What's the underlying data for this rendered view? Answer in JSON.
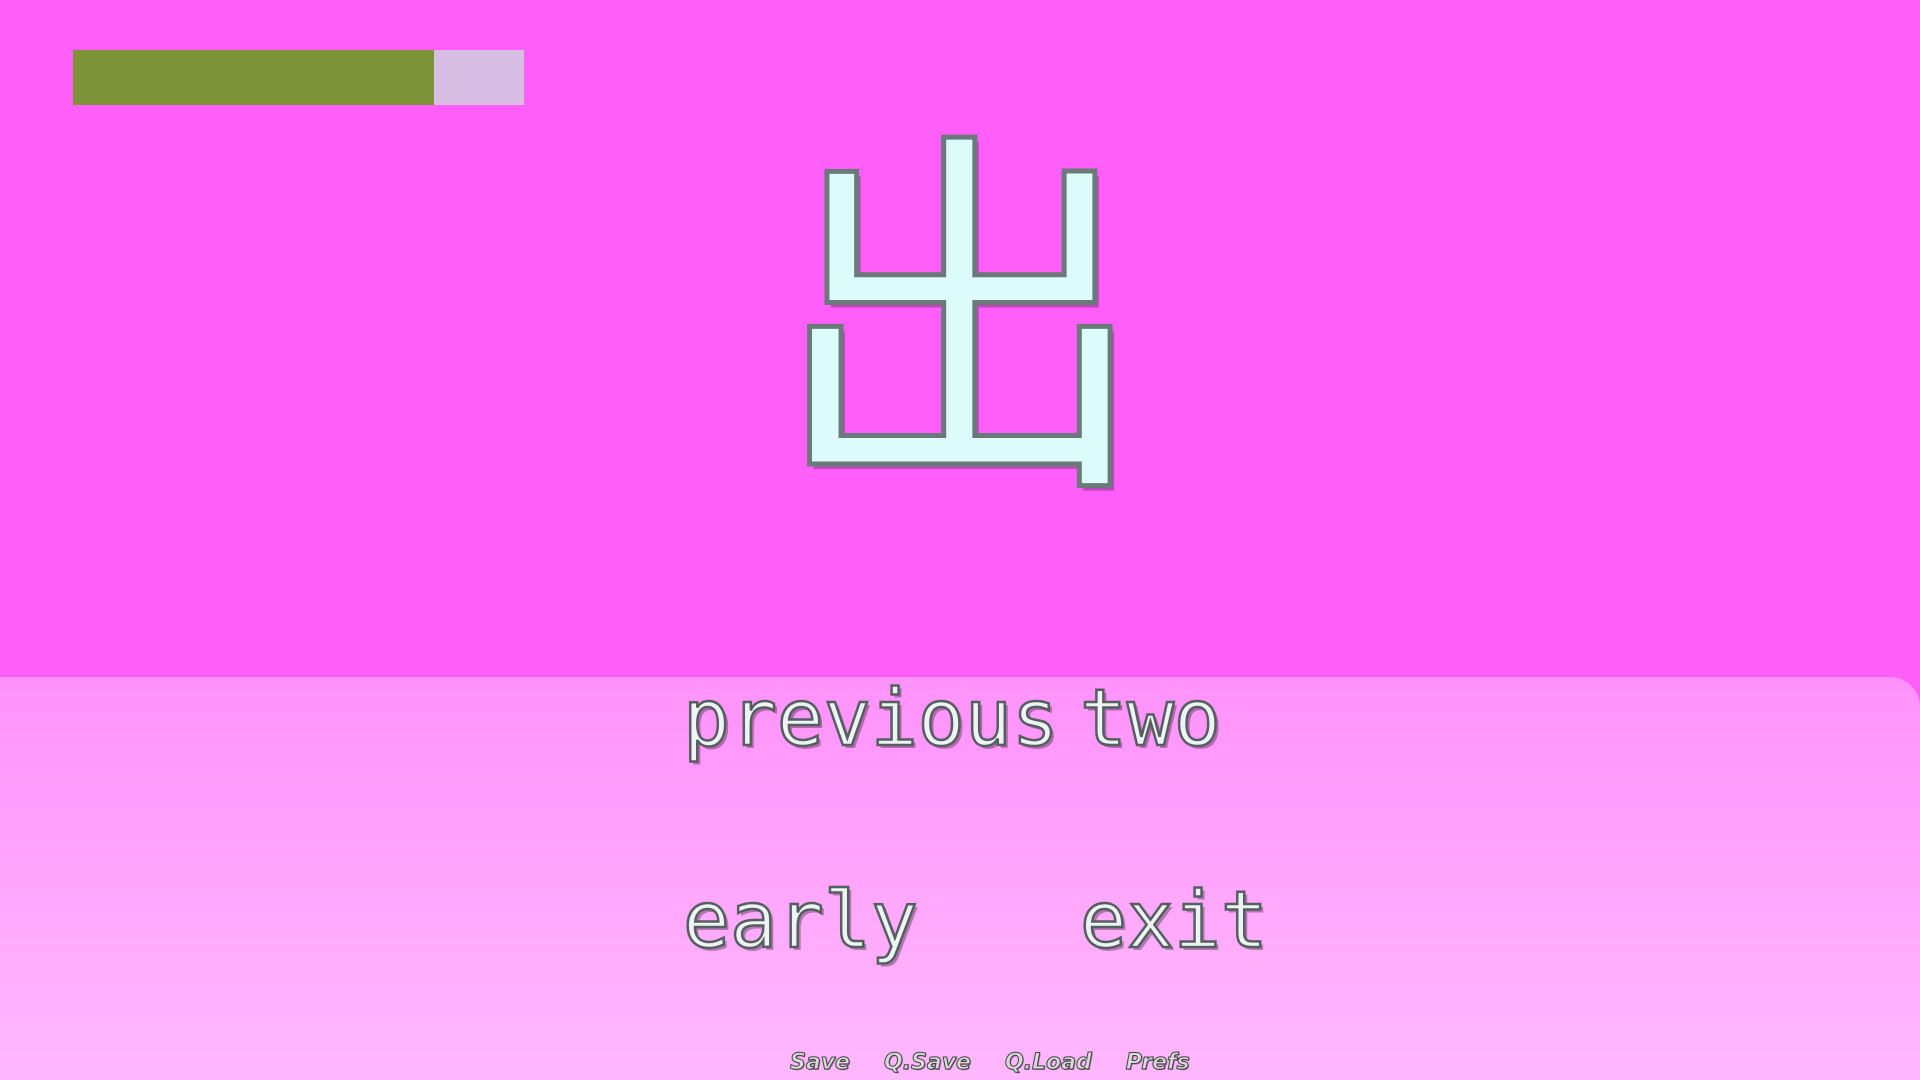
{
  "timer": {
    "remaining_fraction": 0.8,
    "fill_color": "#7c9437",
    "track_color": "#d7bde3"
  },
  "prompt": {
    "kanji": "出",
    "color": "#dcfbfb"
  },
  "choices": [
    {
      "label": "previous"
    },
    {
      "label": "two"
    },
    {
      "label": "early"
    },
    {
      "label": "exit"
    }
  ],
  "quick_menu": {
    "save": "Save",
    "q_save": "Q.Save",
    "q_load": "Q.Load",
    "prefs": "Prefs"
  },
  "colors": {
    "background_top": "#ff5ff8",
    "background_bottom": "#ffb8fd"
  }
}
